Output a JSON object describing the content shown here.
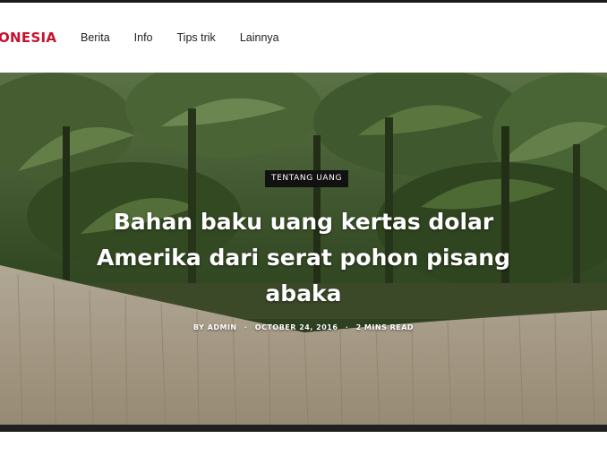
{
  "site": {
    "logo_text": "ONESIA",
    "brand_color": "#c8102e"
  },
  "nav": {
    "items": [
      {
        "label": "Berita"
      },
      {
        "label": "Info"
      },
      {
        "label": "Tips trik"
      },
      {
        "label": "Lainnya"
      }
    ]
  },
  "hero": {
    "category": "TENTANG UANG",
    "title": "Bahan baku uang kertas dolar Amerika dari serat pohon pisang abaka",
    "meta": {
      "author": "BY ADMIN",
      "date": "OCTOBER 24, 2016",
      "read_time": "2 MINS READ"
    }
  }
}
